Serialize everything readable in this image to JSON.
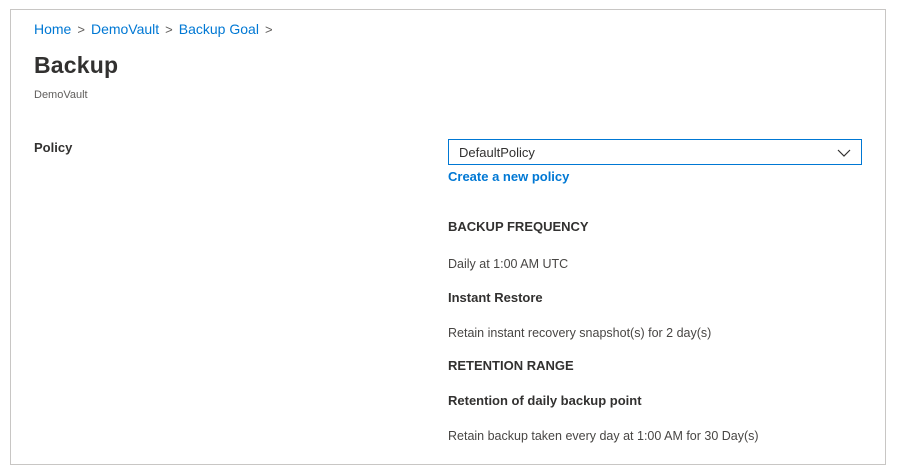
{
  "breadcrumb": {
    "items": [
      "Home",
      "DemoVault",
      "Backup Goal"
    ],
    "separator": ">"
  },
  "page": {
    "title": "Backup",
    "subtitle": "DemoVault"
  },
  "policy": {
    "label": "Policy",
    "selected": "DefaultPolicy",
    "create_link": "Create a new policy"
  },
  "details": {
    "backup_frequency_heading": "BACKUP FREQUENCY",
    "backup_frequency_value": "Daily at 1:00 AM UTC",
    "instant_restore_heading": "Instant Restore",
    "instant_restore_value": "Retain instant recovery snapshot(s) for 2 day(s)",
    "retention_range_heading": "RETENTION RANGE",
    "daily_retention_heading": "Retention of daily backup point",
    "daily_retention_value": "Retain backup taken every day at 1:00 AM for 30 Day(s)"
  },
  "icons": {
    "breadcrumb_separator": "chevron-right-icon",
    "dropdown": "chevron-down-icon"
  },
  "colors": {
    "accent": "#0078d4",
    "text": "#323130",
    "border": "#c8c6c4"
  }
}
